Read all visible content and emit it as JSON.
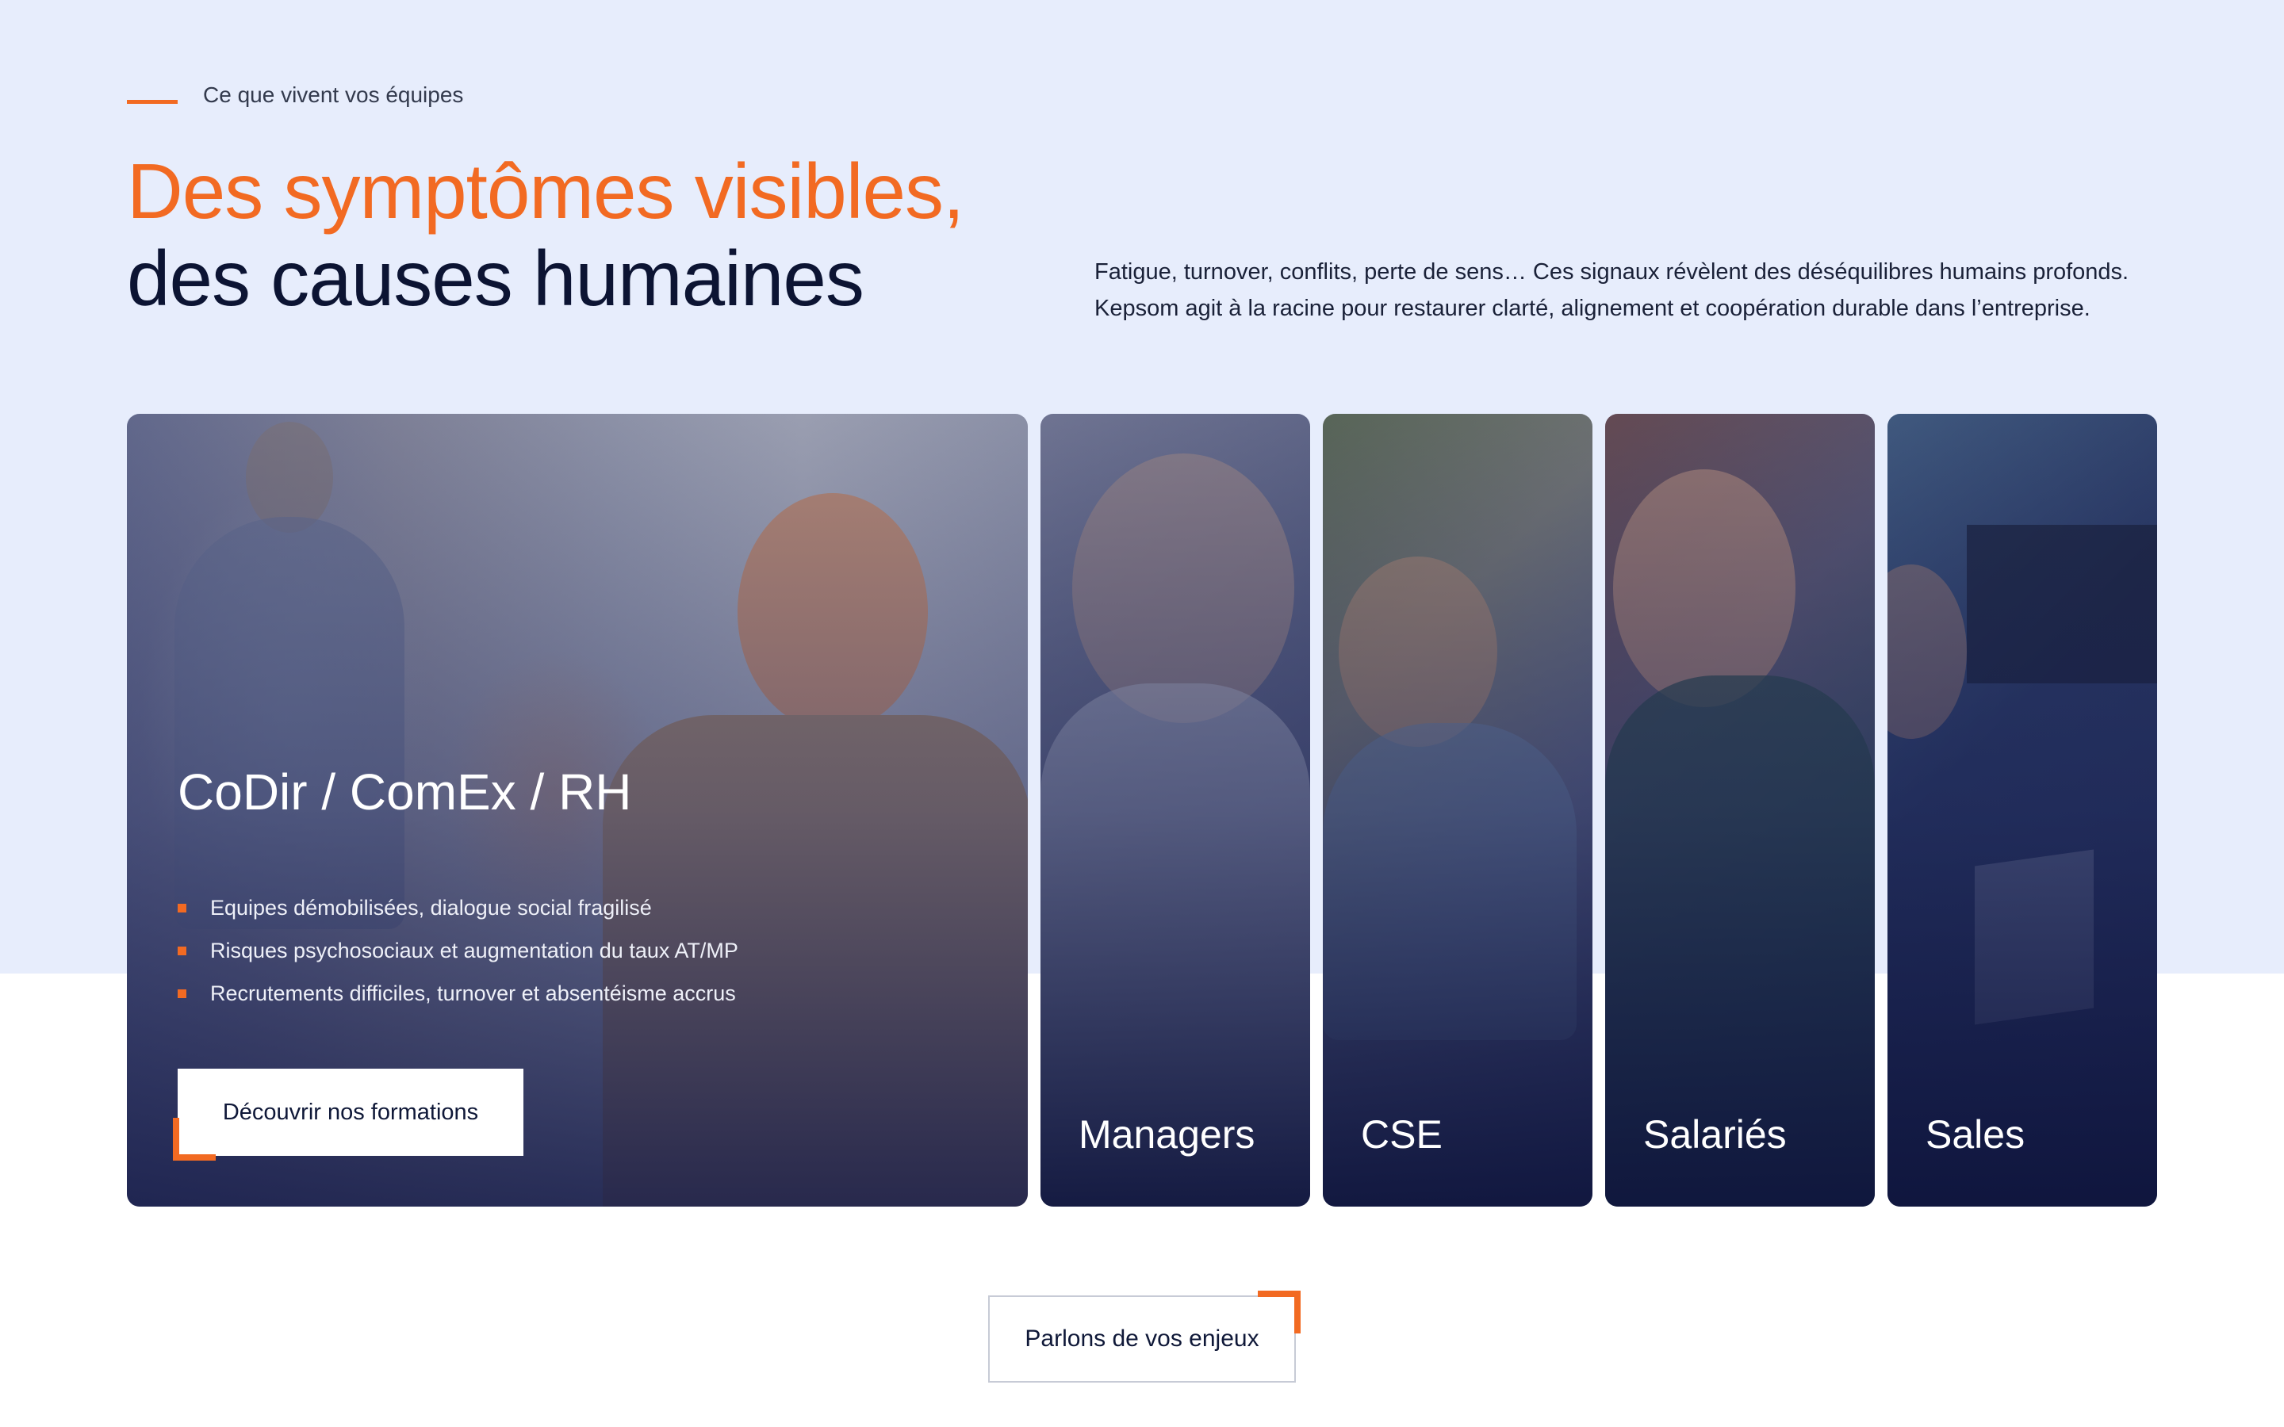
{
  "section": {
    "eyebrow": "Ce que vivent vos équipes",
    "headline_line1": "Des symptômes visibles,",
    "headline_line2": "des causes humaines",
    "intro": "Fatigue, turnover, conflits, perte de sens… Ces signaux révèlent des déséquilibres humains profonds. Kepsom agit à la racine pour restaurer clarté, alignement et coopération durable dans l’entreprise."
  },
  "cards": {
    "main": {
      "title": "CoDir / ComEx / RH",
      "bullets": [
        "Equipes démobilisées, dialogue social fragilisé",
        "Risques psychosociaux et augmentation du taux AT/MP",
        "Recrutements difficiles, turnover et absentéisme accrus"
      ],
      "cta": "Découvrir nos formations"
    },
    "others": [
      {
        "label": "Managers"
      },
      {
        "label": "CSE"
      },
      {
        "label": "Salariés"
      },
      {
        "label": "Sales"
      }
    ]
  },
  "footer_cta": "Parlons de vos enjeux",
  "colors": {
    "accent": "#f26a22",
    "navy": "#0c1433",
    "band": "#e7edfc"
  }
}
